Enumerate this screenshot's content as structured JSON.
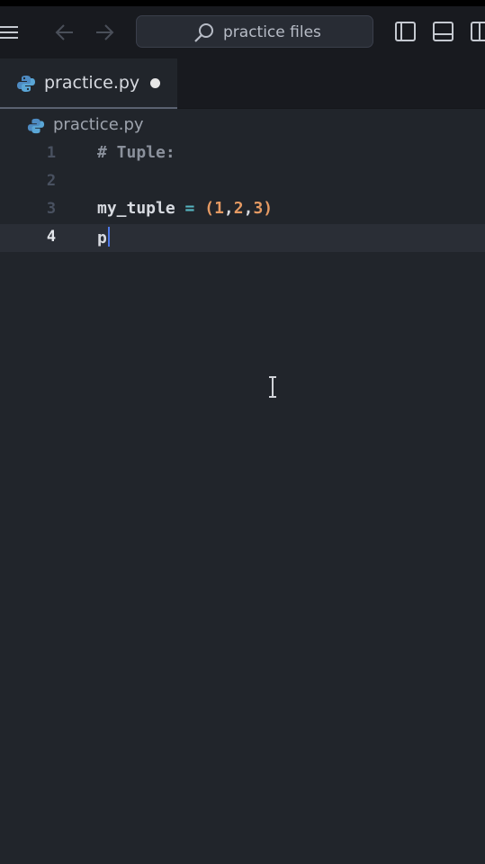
{
  "titlebar": {
    "search_text": "practice files",
    "icons": [
      "menu-icon",
      "back-arrow-icon",
      "forward-arrow-icon",
      "search-icon",
      "toggle-sidebar-icon",
      "toggle-panel-icon",
      "toggle-secondary-sidebar-icon"
    ]
  },
  "tab": {
    "label": "practice.py",
    "icon": "python-icon",
    "dirty": true
  },
  "breadcrumb": {
    "label": "practice.py",
    "icon": "python-icon"
  },
  "editor": {
    "current_line": 4,
    "lines": [
      {
        "number": "1",
        "text": "# Tuple:"
      },
      {
        "number": "2",
        "text": ""
      },
      {
        "number": "3",
        "text": "my_tuple = (1,2,3)"
      },
      {
        "number": "4",
        "text": "p"
      }
    ],
    "tokens_line3": {
      "name": "my_tuple",
      "op": "=",
      "open": "(",
      "n1": "1",
      "n2": "2",
      "n3": "3",
      "close": ")",
      "comma": ","
    }
  },
  "colors": {
    "background": "#21252b",
    "titlebar": "#181a1f",
    "comment": "#8b919c",
    "number": "#e59a63",
    "operator": "#56b6c2",
    "caret": "#4d78e8"
  }
}
